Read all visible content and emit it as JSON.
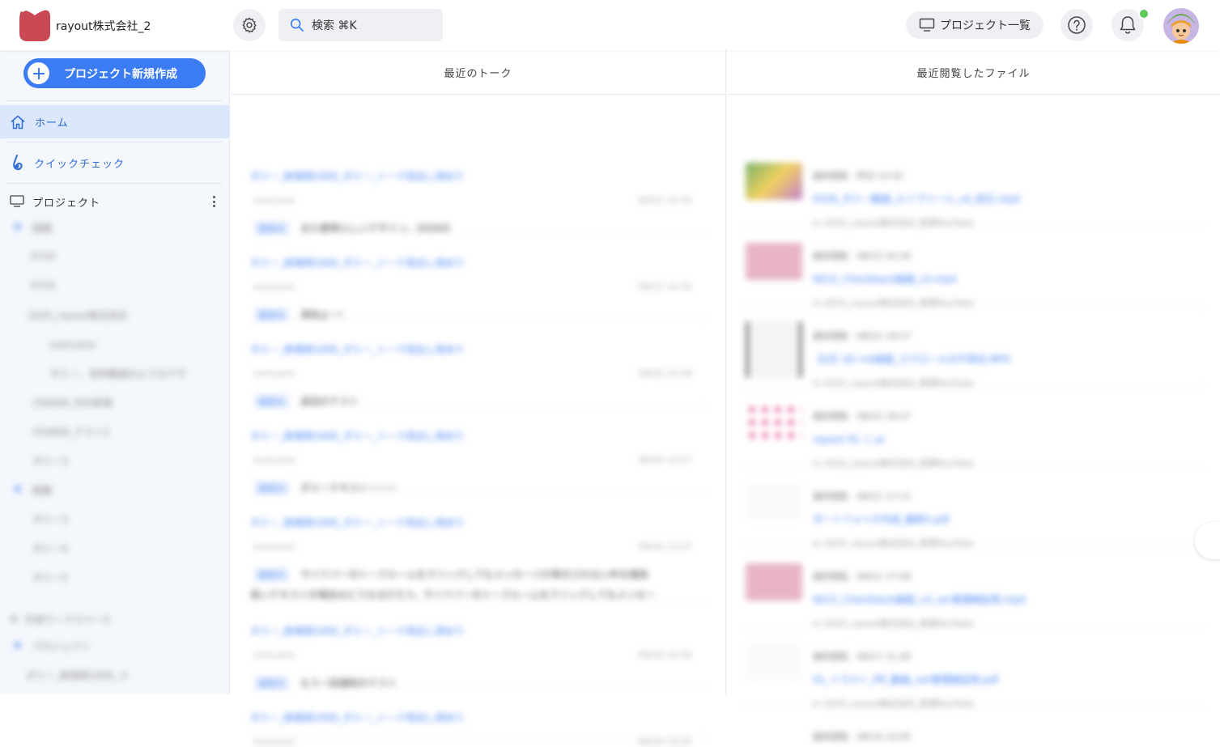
{
  "header": {
    "company_name": "rayout株式会社_2",
    "search_label": "検索 ⌘K",
    "project_list_label": "プロジェクト一覧",
    "accent_color": "#3b7cf5",
    "notification_dot_color": "#5dc95a"
  },
  "sidebar": {
    "new_project_label": "プロジェクト新規作成",
    "nav": [
      {
        "label": "ホーム",
        "icon": "home-icon",
        "active": true
      },
      {
        "label": "クイックチェック",
        "icon": "quick-check-icon",
        "active": false
      }
    ],
    "projects_label": "プロジェクト",
    "tree": [
      {
        "label": "組織"
      },
      {
        "label": "0724"
      },
      {
        "label": "0725"
      },
      {
        "label": "2025_rayout株式会社"
      },
      {
        "label": "everyone"
      },
      {
        "label": "ダミー、有料動画のようなデザ"
      },
      {
        "label": "250606_PJの新規"
      },
      {
        "label": "250606_テスト2"
      },
      {
        "label": "ダミー3"
      },
      {
        "label": "組織"
      },
      {
        "label": "ダミー3"
      },
      {
        "label": "ダミー4"
      },
      {
        "label": "ダミー5"
      },
      {
        "label": "外部ワークスペース"
      },
      {
        "label": "プロジェクト"
      },
      {
        "label": "ダミー_新規用1000_ス"
      }
    ]
  },
  "talk": {
    "header": "最近のトーク",
    "items": [
      {
        "title": "ダミー_新規用1000_ダミー_トーク見出し用あり",
        "user": "everyone",
        "time": "08/31 10:34",
        "tag": "返信元",
        "message": "また素晴らしいデザイン。2026の"
      },
      {
        "title": "ダミー_新規用1000_ダミー_トーク見出し用あり",
        "user": "everyone",
        "time": "08/31 10:34",
        "tag": "返信元",
        "message": "承知よー!"
      },
      {
        "title": "ダミー_新規用1000_ダミー_トーク見出し用あり",
        "user": "everyone",
        "time": "08/26 15:48",
        "tag": "返信元",
        "message": "返信のテスト"
      },
      {
        "title": "ダミー_新規用1000_ダミー_トーク見出し用あり",
        "user": "everyone",
        "time": "08/26 13:27",
        "tag": "返信元",
        "message": "ダミーテキスト〜〜〜"
      },
      {
        "title": "ダミー_新規用1000_ダミー_トーク見出し用あり",
        "user": "everyone",
        "time": "08/26 13:27",
        "tag": "返信元",
        "message": "サイドバーのトークルームをクリックしてもメッセージが表示されない件を報告",
        "message2": "長いテキストの場合はどうなるだろう。サイドバーのトークルームをクリックしてもメッセー"
      },
      {
        "title": "ダミー_新規用1000_ダミー_トーク見出し用あり",
        "user": "everyone",
        "time": "08/26 10:56",
        "tag": "返信元",
        "message": "もう一回通知のテスト"
      },
      {
        "title": "ダミー_新規用1000_ダミー_トーク見出し用あり",
        "user": "everyone",
        "time": "08/26 10:05",
        "tag": "返信元",
        "message": ""
      }
    ]
  },
  "files": {
    "header": "最近閲覧したファイル",
    "items": [
      {
        "meta": "最終閲覧 · 昨日 14:42",
        "name": "0326_ダミー動画_エイプリール_v4_修正.mp4",
        "path": "in 2025_rayout株式会社_新規YouTube"
      },
      {
        "meta": "最終閲覧 · 08/23 16:34",
        "name": "0615_Checkback画面_v3.mp4",
        "path": "in 2025_rayout株式会社_新規YouTube"
      },
      {
        "meta": "最終閲覧 · 08/22 18:27",
        "name": "【UI】QC→UI画面_スクロールの不具合.MP4",
        "path": "in 2025_rayout株式会社_新規YouTube"
      },
      {
        "meta": "最終閲覧 · 08/22 18:27",
        "name": "rayout 01 ⓘ.ai",
        "path": "in 2025_rayout株式会社_新規YouTube"
      },
      {
        "meta": "最終閲覧 · 08/21 17:11",
        "name": "ポートフォリオ作成_最新5.pdf",
        "path": "in 2025_rayout株式会社_新規YouTube"
      },
      {
        "meta": "最終閲覧 · 08/21 17:06",
        "name": "0615_Checkback画面_v3_ver管理検証用.mp4",
        "path": "in 2025_rayout株式会社_新規YouTube"
      },
      {
        "meta": "最終閲覧 · 08/17 11:40",
        "name": "01_イラスト_PR_動画_ver管理検証用.pdf",
        "path": "in 2025_rayout株式会社_新規YouTube"
      },
      {
        "meta": "最終閲覧 · 08/16 14:05",
        "name": "",
        "path": ""
      }
    ]
  }
}
